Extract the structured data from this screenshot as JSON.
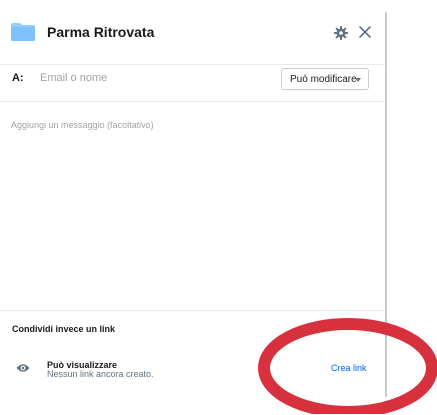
{
  "header": {
    "title": "Parma Ritrovata",
    "folder_icon": "folder-icon",
    "settings_icon": "gear-icon",
    "close_icon": "close-icon"
  },
  "to_row": {
    "label": "A:",
    "placeholder": "Email o nome",
    "permission": "Può modificare"
  },
  "message": {
    "placeholder": "Aggiungi un messaggio (facoltativo)"
  },
  "link_share": {
    "heading": "Condividi invece un link",
    "icon": "eye-icon",
    "title": "Può visualizzare",
    "subtitle": "Nessun link ancora creato.",
    "action": "Crea link"
  },
  "colors": {
    "accent": "#0061fe",
    "folder": "#92ceff",
    "annotation": "#d8313e",
    "divider": "#e6e8eb"
  }
}
